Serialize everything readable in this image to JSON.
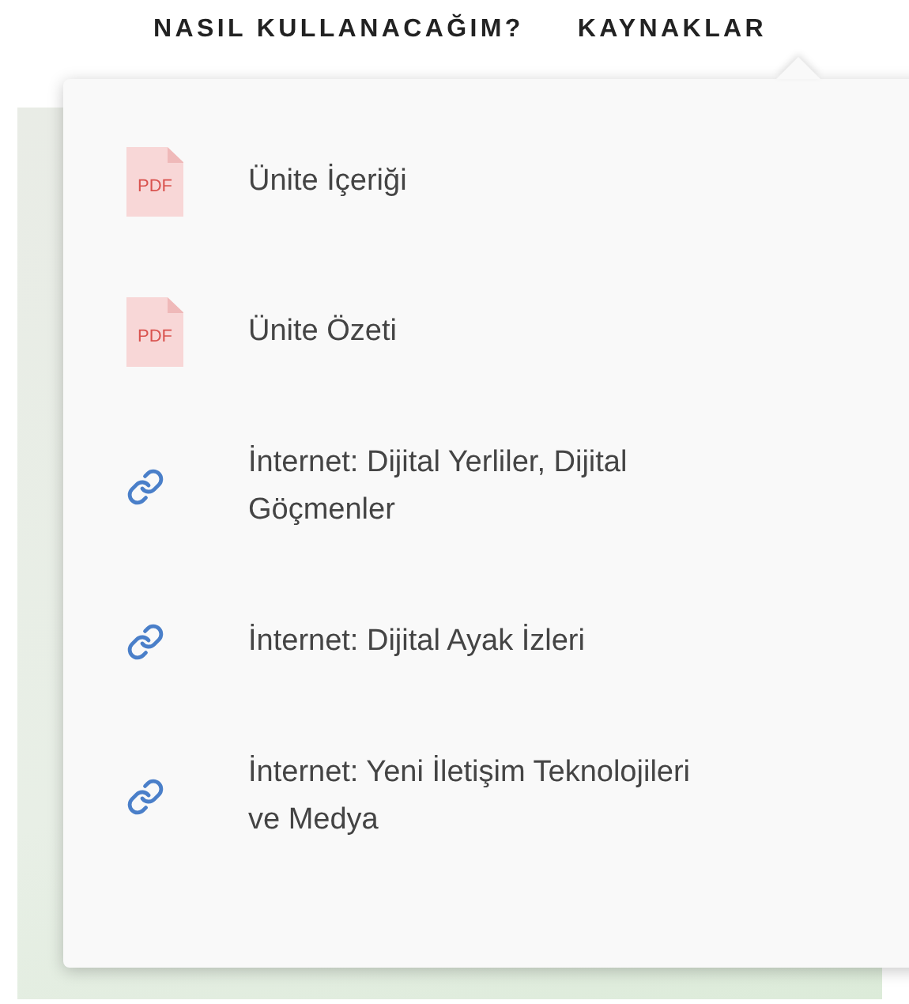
{
  "nav": [
    {
      "label": "NASIL KULLANACAĞIM?"
    },
    {
      "label": "KAYNAKLAR"
    }
  ],
  "resources": [
    {
      "kind": "pdf",
      "badge": "PDF",
      "title": "Ünite İçeriği"
    },
    {
      "kind": "pdf",
      "badge": "PDF",
      "title": "Ünite Özeti"
    },
    {
      "kind": "link",
      "title": "İnternet: Dijital Yerliler, Dijital\nGöçmenler"
    },
    {
      "kind": "link",
      "title": "İnternet: Dijital Ayak İzleri"
    },
    {
      "kind": "link",
      "title": "İnternet: Yeni İletişim Teknolojileri\nve Medya"
    }
  ]
}
